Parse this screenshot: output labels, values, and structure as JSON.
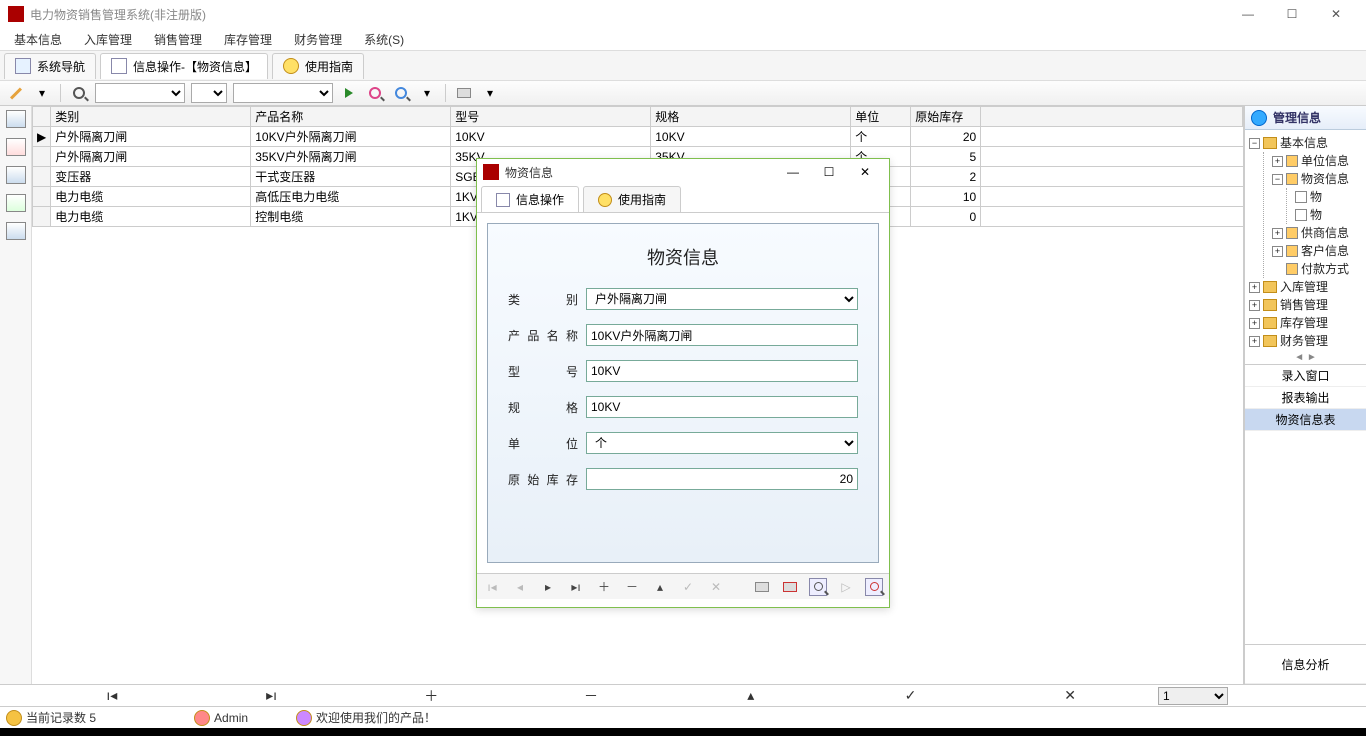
{
  "window": {
    "title": "电力物资销售管理系统(非注册版)"
  },
  "menubar": [
    "基本信息",
    "入库管理",
    "销售管理",
    "库存管理",
    "财务管理",
    "系统(S)"
  ],
  "tabs": [
    {
      "label": "系统导航"
    },
    {
      "label": "信息操作-【物资信息】"
    },
    {
      "label": "使用指南"
    }
  ],
  "grid": {
    "headers": [
      "类别",
      "产品名称",
      "型号",
      "规格",
      "单位",
      "原始库存"
    ],
    "rows": [
      {
        "marker": "▶",
        "cells": [
          "户外隔离刀闸",
          "10KV户外隔离刀闸",
          "10KV",
          "10KV",
          "个",
          "20"
        ]
      },
      {
        "marker": "",
        "cells": [
          "户外隔离刀闸",
          "35KV户外隔离刀闸",
          "35KV",
          "35KV",
          "个",
          "5"
        ]
      },
      {
        "marker": "",
        "cells": [
          "变压器",
          "干式变压器",
          "SGB",
          "",
          "",
          "2"
        ]
      },
      {
        "marker": "",
        "cells": [
          "电力电缆",
          "高低压电力电缆",
          "1KV",
          "",
          "",
          "10"
        ]
      },
      {
        "marker": "",
        "cells": [
          "电力电缆",
          "控制电缆",
          "1KV",
          "",
          "",
          "0"
        ]
      }
    ]
  },
  "right_panel": {
    "title": "管理信息",
    "tree": {
      "label": "基本信息",
      "children": [
        {
          "label": "单位信息",
          "exp": "+"
        },
        {
          "label": "物资信息",
          "exp": "-",
          "children": [
            {
              "label": "物"
            },
            {
              "label": "物"
            }
          ]
        },
        {
          "label": "供商信息",
          "exp": "+"
        },
        {
          "label": "客户信息",
          "exp": "+"
        },
        {
          "label": "付款方式",
          "exp": ""
        }
      ],
      "siblings": [
        "入库管理",
        "销售管理",
        "库存管理",
        "财务管理"
      ]
    },
    "tabs": [
      "录入窗口",
      "报表输出",
      "物资信息表"
    ],
    "analysis": "信息分析"
  },
  "nav_strip": {
    "page_value": "1"
  },
  "statusbar": {
    "record_count": "当前记录数  5",
    "user": "Admin",
    "welcome": "欢迎使用我们的产品！"
  },
  "modal": {
    "title": "物资信息",
    "tabs": [
      "信息操作",
      "使用指南"
    ],
    "form_title": "物资信息",
    "fields": {
      "category_label": "类　　别",
      "category_value": "户外隔离刀闸",
      "name_label": "产品名称",
      "name_value": "10KV户外隔离刀闸",
      "model_label": "型　　号",
      "model_value": "10KV",
      "spec_label": "规　　格",
      "spec_value": "10KV",
      "unit_label": "单　　位",
      "unit_value": "个",
      "stock_label": "原始库存",
      "stock_value": "20"
    }
  }
}
